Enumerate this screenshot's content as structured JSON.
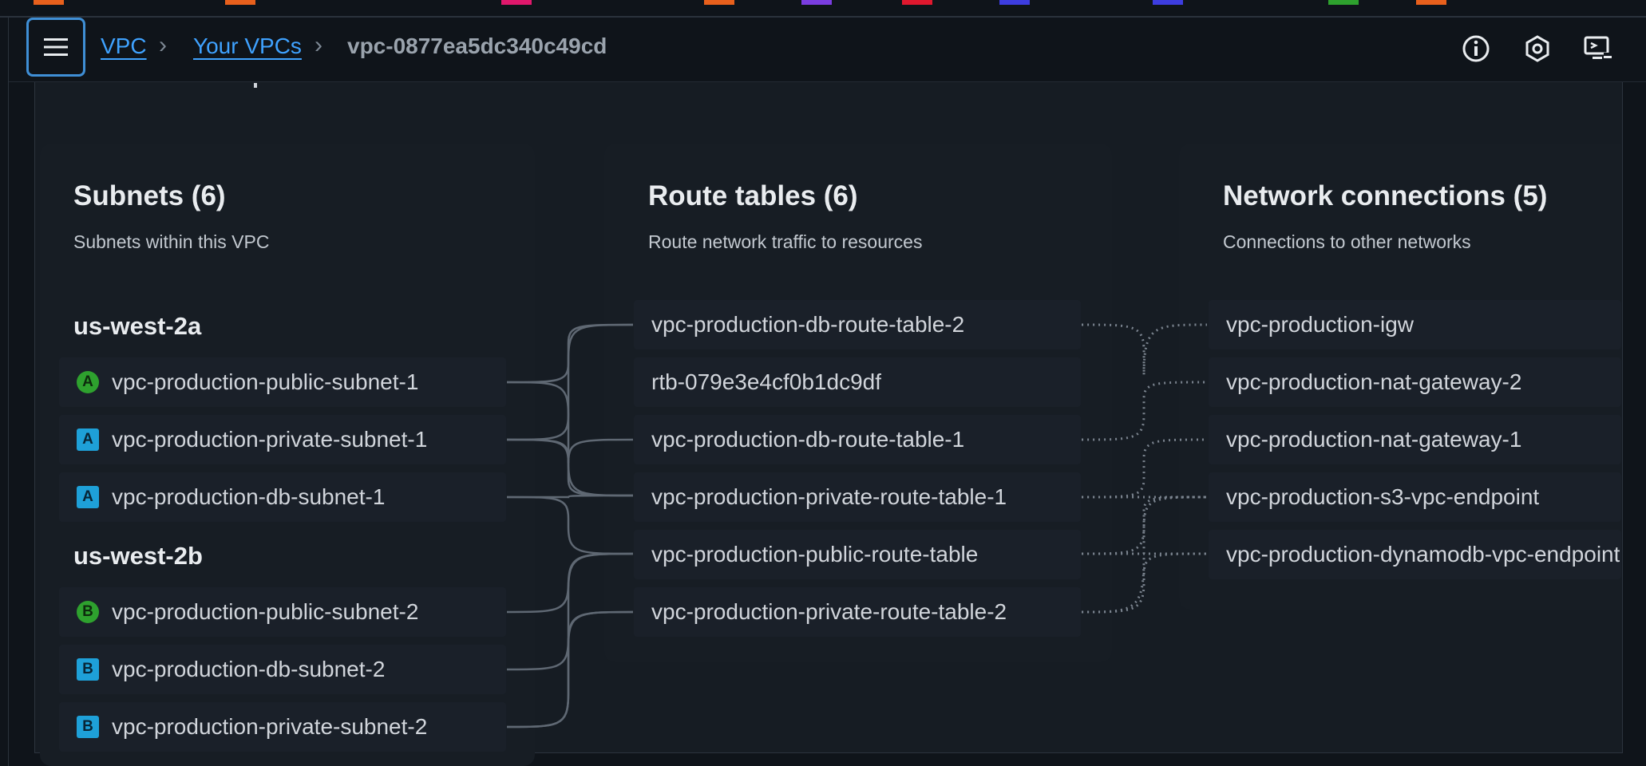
{
  "colors": {
    "accent": "#3fa2ff",
    "public_badge": "#2ea12e",
    "private_badge": "#1ea0d8",
    "top_chips": [
      "#e8601c",
      "#e8601c",
      "#e0186c",
      "#e8601c",
      "#7a3de0",
      "#e0182e",
      "#3d3de0",
      "#3d3de0",
      "#2ea12e",
      "#e8601c"
    ]
  },
  "breadcrumb": {
    "items": [
      {
        "label": "VPC",
        "link": true
      },
      {
        "label": "Your VPCs",
        "link": true
      },
      {
        "label": "vpc-0877ea5dc340c49cd",
        "link": false
      }
    ]
  },
  "header_icons": [
    "info-icon",
    "notifications-icon",
    "display-settings-icon"
  ],
  "subnets": {
    "title": "Subnets (6)",
    "subtitle": "Subnets within this VPC",
    "zones": [
      {
        "name": "us-west-2a",
        "items": [
          {
            "label": "vpc-production-public-subnet-1",
            "badge": "A",
            "type": "public"
          },
          {
            "label": "vpc-production-private-subnet-1",
            "badge": "A",
            "type": "private"
          },
          {
            "label": "vpc-production-db-subnet-1",
            "badge": "A",
            "type": "private"
          }
        ]
      },
      {
        "name": "us-west-2b",
        "items": [
          {
            "label": "vpc-production-public-subnet-2",
            "badge": "B",
            "type": "public"
          },
          {
            "label": "vpc-production-db-subnet-2",
            "badge": "B",
            "type": "private"
          },
          {
            "label": "vpc-production-private-subnet-2",
            "badge": "B",
            "type": "private"
          }
        ]
      }
    ]
  },
  "route_tables": {
    "title": "Route tables (6)",
    "subtitle": "Route network traffic to resources",
    "items": [
      "vpc-production-db-route-table-2",
      "rtb-079e3e4cf0b1dc9df",
      "vpc-production-db-route-table-1",
      "vpc-production-private-route-table-1",
      "vpc-production-public-route-table",
      "vpc-production-private-route-table-2"
    ]
  },
  "network_connections": {
    "title": "Network connections (5)",
    "subtitle": "Connections to other networks",
    "items": [
      "vpc-production-igw",
      "vpc-production-nat-gateway-2",
      "vpc-production-nat-gateway-1",
      "vpc-production-s3-vpc-endpoint",
      "vpc-production-dynamodb-vpc-endpoint"
    ]
  }
}
